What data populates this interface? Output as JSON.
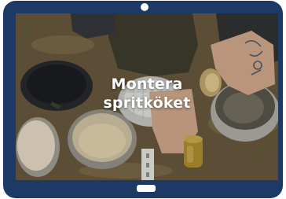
{
  "video": {
    "title_line1": "Montera",
    "title_line2": "spritköket"
  },
  "device": {
    "frame_color": "#1d3a66"
  }
}
